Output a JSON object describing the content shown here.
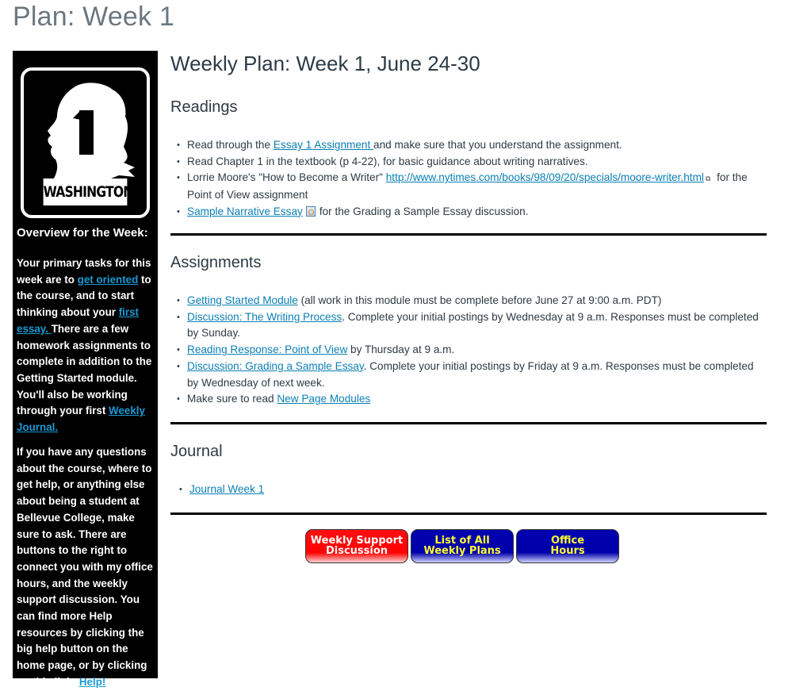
{
  "page_title": "Plan: Week 1",
  "sidebar": {
    "sign": {
      "number": "1",
      "label": "WASHINGTON",
      "icon": "washington-highway-sign"
    },
    "heading": "Overview for the Week:",
    "para1": {
      "t1": "Your primary tasks for this week are to ",
      "link1": "get oriented",
      "t2": " to the course, and to start thinking about your ",
      "link2": "first essay. ",
      "t3": "There are a few homework assignments to complete in addition to the Getting Started module. You'll also be working through your first ",
      "link3": "Weekly Journal."
    },
    "para2": {
      "t1": "If you have any questions about the course, where to get help, or anything else about being a student at Bellevue College, make sure to ask. There are buttons to the right to connect you with my office hours, and the weekly support discussion. You can find more Help resources by clicking the big help button on the home page, or by clicking on this link: ",
      "link1": "Help!"
    }
  },
  "main": {
    "title": "Weekly Plan: Week 1, June 24-30",
    "readings": {
      "heading": "Readings",
      "items": [
        {
          "pre": "Read through the ",
          "link": "Essay 1 Assignment ",
          "post": "and make sure that you understand the assignment."
        },
        {
          "pre": "Read Chapter 1 in the textbook (p 4-22), for basic guidance about writing narratives.",
          "link": "",
          "post": ""
        },
        {
          "pre": "Lorrie Moore's \"How to Become a Writer\" ",
          "link": "http://www.nytimes.com/books/98/09/20/specials/moore-writer.html",
          "post": " for the Point of View assignment",
          "icon": "external-link-icon"
        },
        {
          "pre": "",
          "link": "Sample Narrative Essay",
          "post": "for the Grading a Sample Essay discussion.",
          "icon": "document-preview-icon"
        }
      ]
    },
    "assignments": {
      "heading": "Assignments",
      "items": [
        {
          "link": "Getting Started Module",
          "post": " (all work in this module must be complete before June 27 at 9:00 a.m. PDT)"
        },
        {
          "link": "Discussion: The Writing Process",
          "post": ". Complete your initial postings by Wednesday at 9 a.m. Responses must be completed by Sunday."
        },
        {
          "link": "Reading Response: Point of View",
          "post": " by Thursday at 9 a.m."
        },
        {
          "link": "Discussion: Grading a Sample Essay",
          "post": ". Complete your initial postings by Friday at 9 a.m. Responses must be completed by Wednesday of next week."
        },
        {
          "pre": "Make sure to read ",
          "link": "New Page Modules",
          "post": ""
        }
      ]
    },
    "journal": {
      "heading": "Journal",
      "items": [
        {
          "link": "Journal Week 1"
        }
      ]
    },
    "buttons": [
      {
        "line1": "Weekly Support",
        "line2": "Discussion",
        "color": "#ff0000",
        "text_color": "#ffffff"
      },
      {
        "line1": "List of All",
        "line2": "Weekly Plans",
        "color": "#0000aa",
        "text_color": "#ffff33"
      },
      {
        "line1": "Office",
        "line2": "Hours",
        "color": "#0000aa",
        "text_color": "#ffff33"
      }
    ]
  }
}
